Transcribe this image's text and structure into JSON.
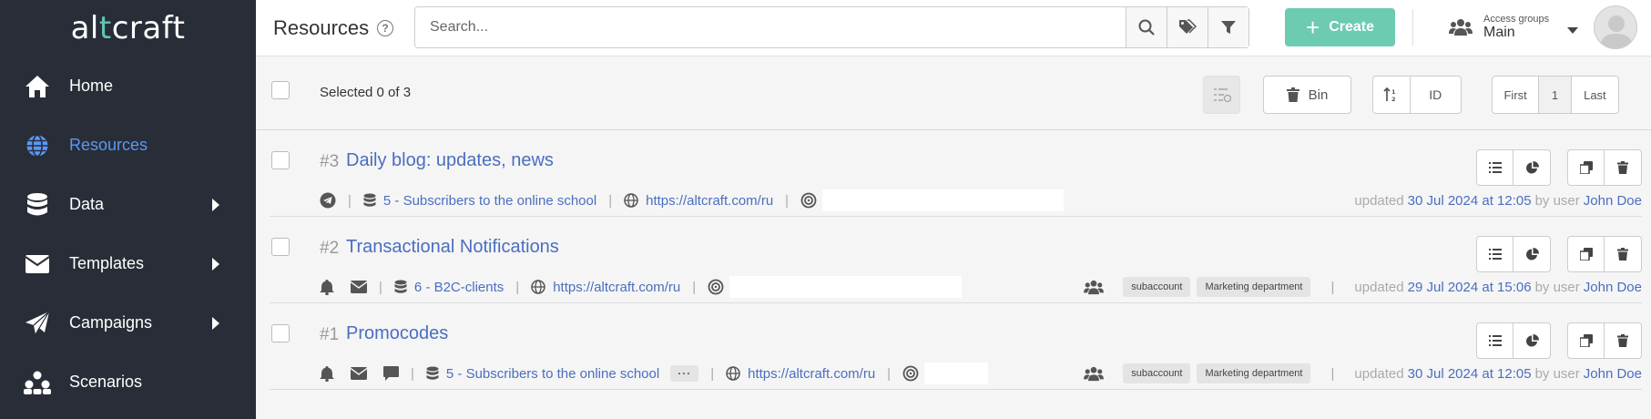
{
  "logo": {
    "pre": "al",
    "accent": "t",
    "post": "craft"
  },
  "sidebar": {
    "items": [
      {
        "label": "Home",
        "icon": "home-icon"
      },
      {
        "label": "Resources",
        "icon": "globe-icon",
        "active": true
      },
      {
        "label": "Data",
        "icon": "database-icon",
        "has_submenu": true
      },
      {
        "label": "Templates",
        "icon": "envelope-icon",
        "has_submenu": true
      },
      {
        "label": "Campaigns",
        "icon": "paper-plane-icon",
        "has_submenu": true
      },
      {
        "label": "Scenarios",
        "icon": "scenarios-icon"
      }
    ]
  },
  "header": {
    "title": "Resources",
    "search_placeholder": "Search...",
    "create_label": "Create",
    "access_groups_label": "Access groups",
    "access_groups_value": "Main"
  },
  "toolbar": {
    "selected_text": "Selected 0 of 3",
    "bin_label": "Bin",
    "sort_field": "ID",
    "pagination": {
      "first": "First",
      "current": "1",
      "last": "Last"
    }
  },
  "rows": [
    {
      "id": "#3",
      "title": "Daily blog: updates, news",
      "channels": [
        "telegram-icon"
      ],
      "database": "5 - Subscribers to the online school",
      "url": "https://altcraft.com/ru",
      "updated_prefix": "updated",
      "updated_date": "30 Jul 2024 at 12:05",
      "by_user": "by user",
      "user": "John Doe",
      "tags": []
    },
    {
      "id": "#2",
      "title": "Transactional Notifications",
      "channels": [
        "bell-icon",
        "envelope-icon"
      ],
      "database": "6 - B2C-clients",
      "url": "https://altcraft.com/ru",
      "updated_prefix": "updated",
      "updated_date": "29 Jul 2024 at 15:06",
      "by_user": "by user",
      "user": "John Doe",
      "tags": [
        "subaccount",
        "Marketing department"
      ]
    },
    {
      "id": "#1",
      "title": "Promocodes",
      "channels": [
        "bell-icon",
        "envelope-icon",
        "chat-icon"
      ],
      "database": "5 - Subscribers to the online school",
      "more": "···",
      "url": "https://altcraft.com/ru",
      "updated_prefix": "updated",
      "updated_date": "30 Jul 2024 at 12:05",
      "by_user": "by user",
      "user": "John Doe",
      "tags": [
        "subaccount",
        "Marketing department"
      ]
    }
  ],
  "colors": {
    "sidebar_bg": "#282d37",
    "accent_teal": "#6ccbb1",
    "link_blue": "#4a6ec0",
    "active_nav": "#5b97f5"
  }
}
